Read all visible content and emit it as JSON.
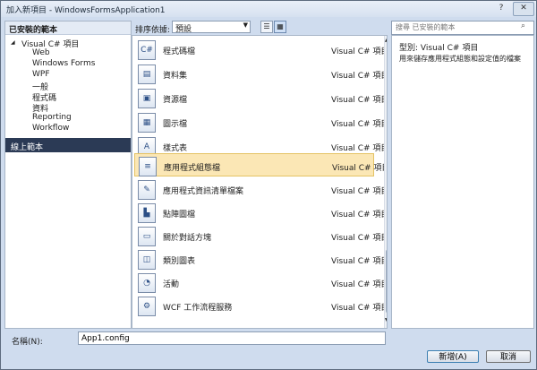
{
  "window": {
    "title": "加入新項目 - WindowsFormsApplication1",
    "help": "?",
    "close": "✕"
  },
  "left": {
    "installed_header": "已安裝的範本",
    "root": "Visual C# 項目",
    "children": [
      "Web",
      "Windows Forms",
      "WPF",
      "一般",
      "程式碼",
      "資料",
      "Reporting",
      "Workflow"
    ],
    "online": "線上範本"
  },
  "toolbar": {
    "sort_label": "排序依據:",
    "sort_value": "預設"
  },
  "search": {
    "placeholder": "搜尋 已安裝的範本"
  },
  "items": [
    {
      "name": "程式碼檔",
      "type": "Visual C# 項目",
      "icon": "code-file-icon"
    },
    {
      "name": "資料集",
      "type": "Visual C# 項目",
      "icon": "dataset-icon"
    },
    {
      "name": "資源檔",
      "type": "Visual C# 項目",
      "icon": "resource-file-icon"
    },
    {
      "name": "圖示檔",
      "type": "Visual C# 項目",
      "icon": "icon-file-icon"
    },
    {
      "name": "樣式表",
      "type": "Visual C# 項目",
      "icon": "stylesheet-icon"
    },
    {
      "name": "應用程式組態檔",
      "type": "Visual C# 項目",
      "icon": "config-file-icon"
    },
    {
      "name": "應用程式資訊清單檔案",
      "type": "Visual C# 項目",
      "icon": "manifest-file-icon"
    },
    {
      "name": "點陣圖檔",
      "type": "Visual C# 項目",
      "icon": "bitmap-icon"
    },
    {
      "name": "關於對話方塊",
      "type": "Visual C# 項目",
      "icon": "about-dialog-icon"
    },
    {
      "name": "類別圖表",
      "type": "Visual C# 項目",
      "icon": "class-diagram-icon"
    },
    {
      "name": "活動",
      "type": "Visual C# 項目",
      "icon": "activity-icon"
    },
    {
      "name": "WCF 工作流程服務",
      "type": "Visual C# 項目",
      "icon": "wcf-workflow-icon"
    }
  ],
  "selected_item": "應用程式組態檔",
  "details": {
    "type_label": "型別:",
    "type_value": "Visual C# 項目",
    "description": "用來儲存應用程式組態和設定值的檔案"
  },
  "name_field": {
    "label": "名稱(N):",
    "value": "App1.config"
  },
  "buttons": {
    "add": "新增(A)",
    "cancel": "取消"
  },
  "colors": {
    "selection": "#fbe7b5",
    "online_header": "#2b3a55",
    "window_bg": "#cfdcee"
  }
}
